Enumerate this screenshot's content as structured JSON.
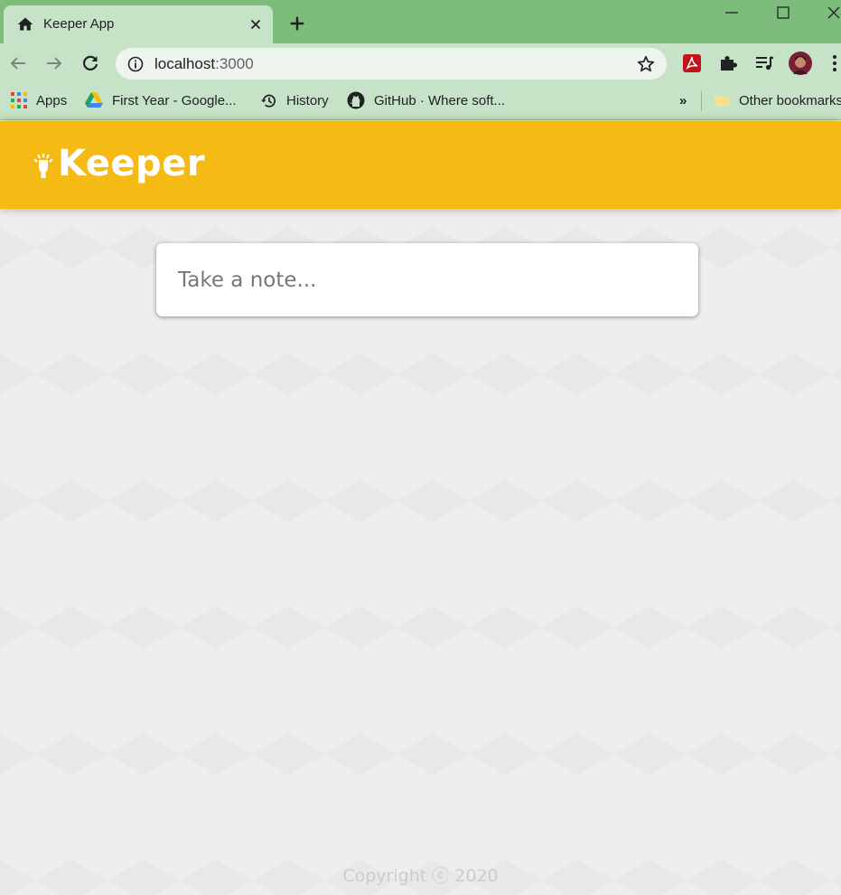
{
  "browser": {
    "tab_title": "Keeper App",
    "url_host": "localhost",
    "url_port": ":3000",
    "bookmarks": [
      {
        "label": "Apps",
        "icon": "apps-grid-icon"
      },
      {
        "label": "First Year - Google...",
        "icon": "google-drive-icon"
      },
      {
        "label": "History",
        "icon": "history-icon"
      },
      {
        "label": "GitHub · Where soft...",
        "icon": "github-icon"
      }
    ],
    "overflow_label": "»",
    "other_bookmarks": "Other bookmarks"
  },
  "app": {
    "logo_text": "Keeper",
    "note_placeholder": "Take a note...",
    "footer": "Copyright ⓒ 2020",
    "accent": "#f5ba13",
    "background": "#eeeeee"
  }
}
